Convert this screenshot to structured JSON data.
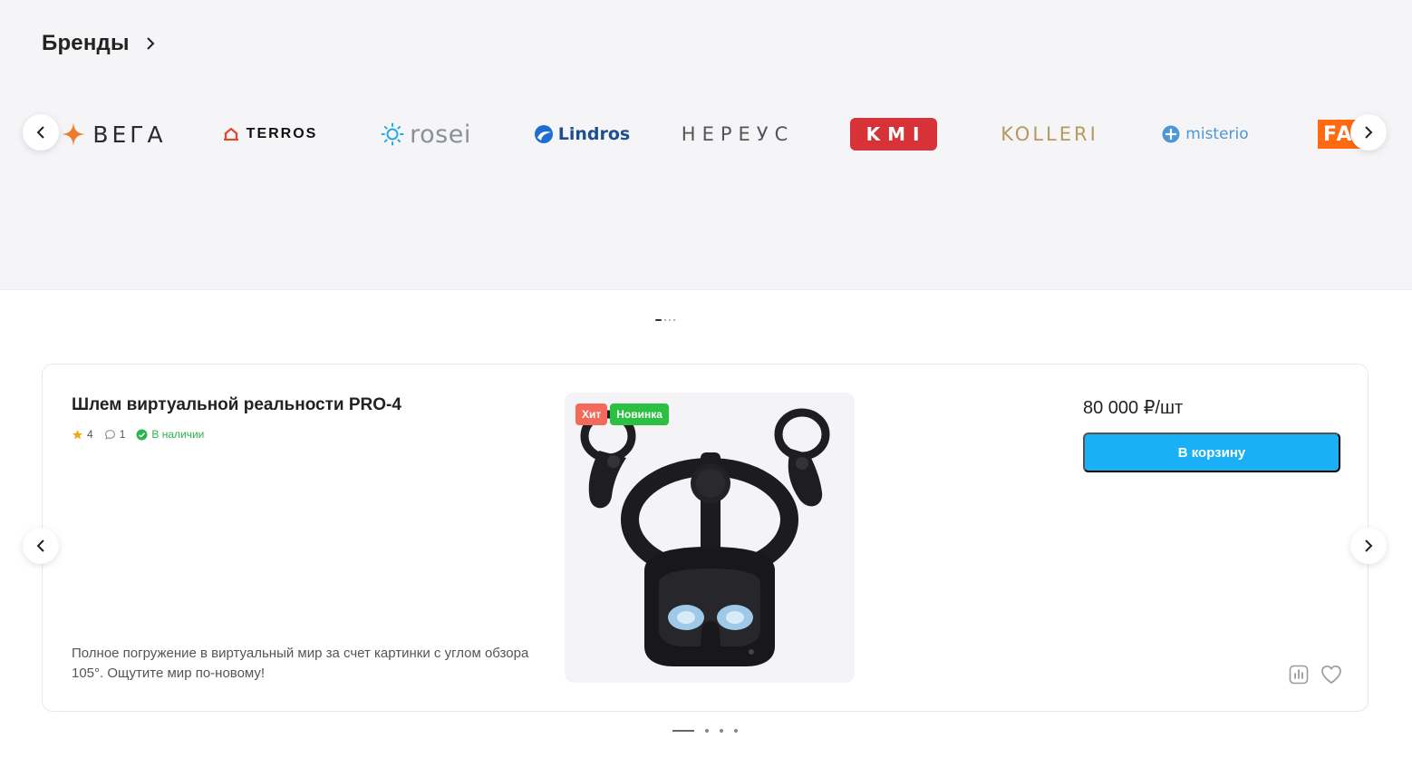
{
  "brands": {
    "title": "Бренды",
    "items": [
      {
        "name": "ВЕГА"
      },
      {
        "name": "TERROS"
      },
      {
        "name": "rosei"
      },
      {
        "name": "Lindros"
      },
      {
        "name": "НЕРЕУС"
      },
      {
        "name": "KMI"
      },
      {
        "name": "KOLLERI"
      },
      {
        "name": "misterio"
      },
      {
        "name": "FA"
      }
    ]
  },
  "product": {
    "title": "Шлем виртуальной реальности PRO-4",
    "rating": "4",
    "reviews": "1",
    "stock": "В наличии",
    "description": "Полное погружение в виртуальный мир за счет картинки с углом обзора 105°. Ощутите мир по-новому!",
    "badges": {
      "hit": "Хит",
      "new": "Новинка"
    },
    "price": "80 000 ₽/шт",
    "cart_label": "В корзину"
  },
  "colors": {
    "accent": "#1ab0f5",
    "badge_hit": "#f36a5a",
    "badge_new": "#2cc043",
    "in_stock": "#2cb34a"
  }
}
